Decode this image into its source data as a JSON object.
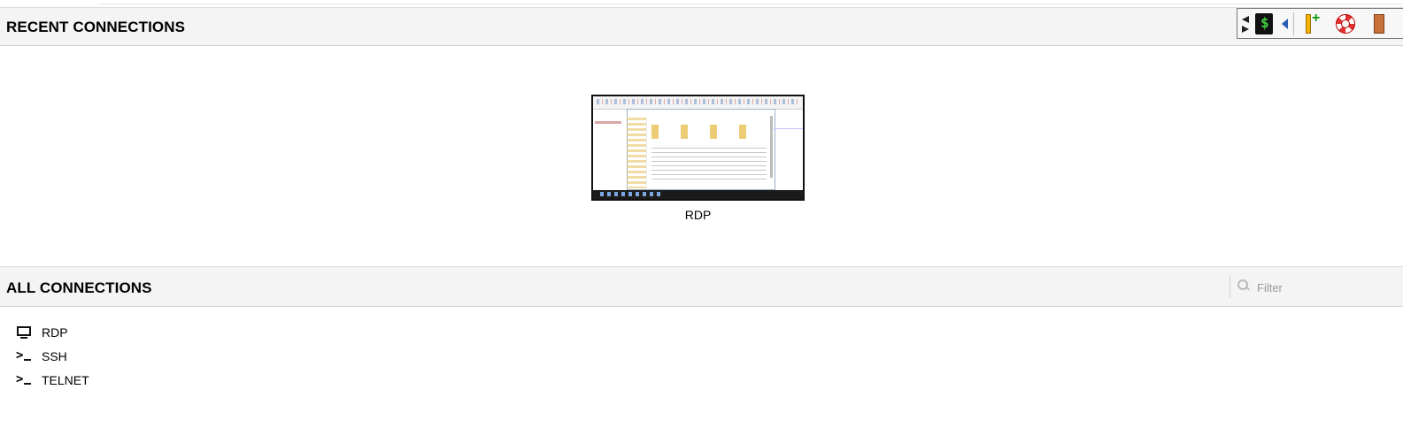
{
  "recent": {
    "heading": "RECENT CONNECTIONS",
    "tiles": [
      {
        "label": "RDP"
      }
    ]
  },
  "toolbar": {
    "icons": [
      "scroll-left-icon",
      "terminal-dollar-icon",
      "back-icon",
      "add-bookmark-icon",
      "help-lifebuoy-icon",
      "logout-door-icon"
    ]
  },
  "all": {
    "heading": "ALL CONNECTIONS",
    "filter_placeholder": "Filter",
    "items": [
      {
        "label": "RDP",
        "icon": "monitor-icon"
      },
      {
        "label": "SSH",
        "icon": "terminal-prompt-icon"
      },
      {
        "label": "TELNET",
        "icon": "terminal-prompt-icon"
      }
    ]
  },
  "colors": {
    "header_bg": "#f4f4f4",
    "prompt_accent": "#3fd13f",
    "bookmark": "#f0b400",
    "help": "#e03030"
  }
}
